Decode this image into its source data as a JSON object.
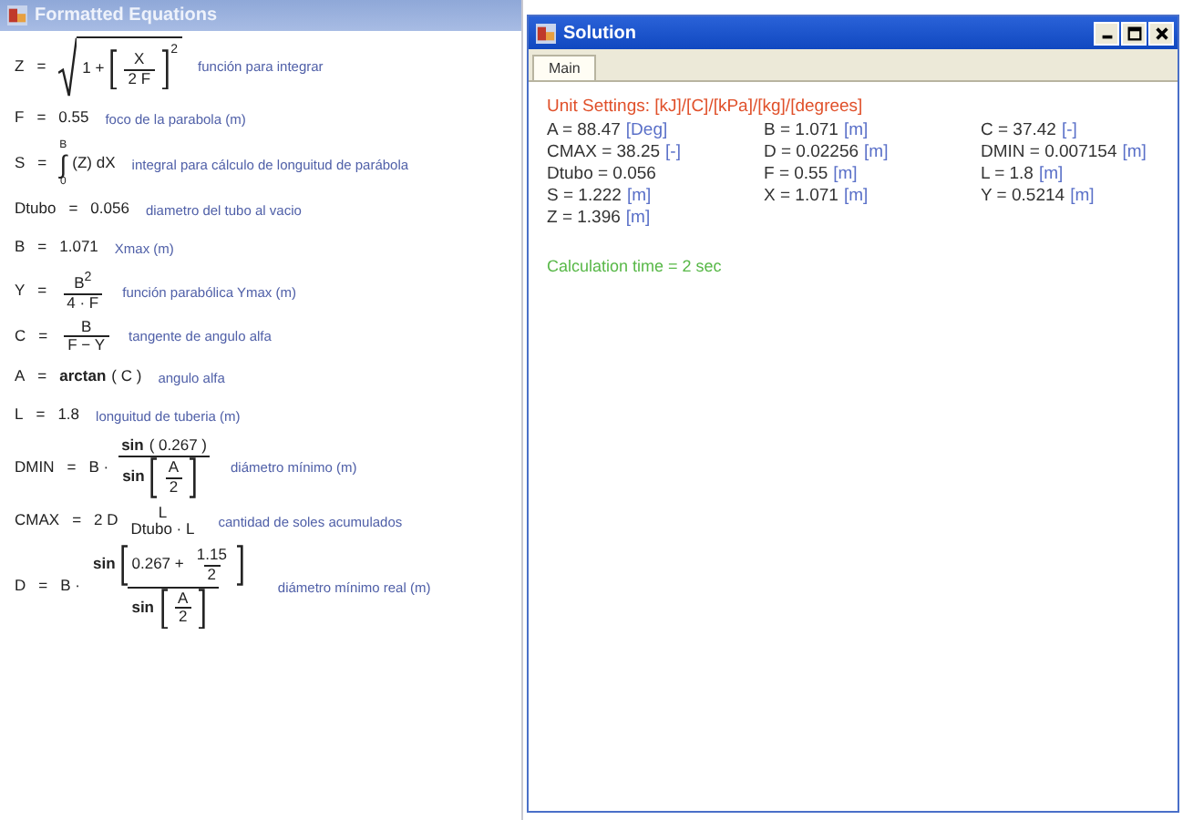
{
  "equations_window": {
    "title": "Formatted Equations"
  },
  "equations": [
    {
      "lhs": "Z",
      "op": "=",
      "expr": [
        {
          "kind": "sqrt",
          "body": [
            {
              "kind": "text",
              "text": "1 +"
            },
            {
              "kind": "brackets",
              "sup": "2",
              "body": [
                {
                  "kind": "frac",
                  "num": [
                    {
                      "kind": "text",
                      "text": "X"
                    }
                  ],
                  "den": [
                    {
                      "kind": "text",
                      "text": "2 F"
                    }
                  ]
                }
              ]
            }
          ]
        }
      ],
      "comment": "función para integrar"
    },
    {
      "lhs": "F",
      "op": "=",
      "expr": [
        {
          "kind": "text",
          "text": "0.55"
        }
      ],
      "comment": "foco de la parabola (m)"
    },
    {
      "lhs": "S",
      "op": "=",
      "expr": [
        {
          "kind": "integral",
          "sign": "∫",
          "upper": "B",
          "lower": "0"
        },
        {
          "kind": "text",
          "text": "(Z)  dX"
        }
      ],
      "comment": "integral para cálculo de longuitud de parábola"
    },
    {
      "lhs": "Dtubo",
      "op": "=",
      "expr": [
        {
          "kind": "text",
          "text": "0.056"
        }
      ],
      "comment": "diametro del tubo al vacio"
    },
    {
      "lhs": "B",
      "op": "=",
      "expr": [
        {
          "kind": "text",
          "text": "1.071"
        }
      ],
      "comment": "Xmax (m)"
    },
    {
      "lhs": "Y",
      "op": "=",
      "expr": [
        {
          "kind": "frac",
          "num": [
            {
              "kind": "text",
              "text": "B$^{2}$"
            }
          ],
          "den": [
            {
              "kind": "text",
              "text": "4 · F"
            }
          ]
        }
      ],
      "comment": "función parabólica Ymax (m)"
    },
    {
      "lhs": "C",
      "op": "=",
      "expr": [
        {
          "kind": "frac",
          "num": [
            {
              "kind": "text",
              "text": "B"
            }
          ],
          "den": [
            {
              "kind": "text",
              "text": "F − Y"
            }
          ]
        }
      ],
      "comment": "tangente de angulo alfa"
    },
    {
      "lhs": "A",
      "op": "=",
      "expr": [
        {
          "kind": "text",
          "text": "arctan",
          "bold": true
        },
        {
          "kind": "text",
          "text": "( C )"
        }
      ],
      "comment": "angulo alfa"
    },
    {
      "lhs": "L",
      "op": "=",
      "expr": [
        {
          "kind": "text",
          "text": "1.8"
        }
      ],
      "comment": "longuitud de tuberia (m)"
    },
    {
      "lhs": "DMIN",
      "op": "=",
      "expr": [
        {
          "kind": "text",
          "text": "B ·"
        },
        {
          "kind": "frac",
          "num": [
            {
              "kind": "text",
              "text": "sin",
              "bold": true
            },
            {
              "kind": "text",
              "text": "( 0.267 )"
            }
          ],
          "den": [
            {
              "kind": "text",
              "text": "sin",
              "bold": true
            },
            {
              "kind": "brackets",
              "body": [
                {
                  "kind": "frac",
                  "num": [
                    {
                      "kind": "text",
                      "text": "A"
                    }
                  ],
                  "den": [
                    {
                      "kind": "text",
                      "text": "2"
                    }
                  ]
                }
              ]
            }
          ]
        }
      ],
      "comment": "diámetro mínimo (m)"
    },
    {
      "lhs": "CMAX",
      "op": "=",
      "expr": [
        {
          "kind": "text",
          "text": "2   D"
        },
        {
          "kind": "frac",
          "plain": true,
          "num": [
            {
              "kind": "text",
              "text": "L"
            }
          ],
          "den": [
            {
              "kind": "text",
              "text": "Dtubo · L"
            }
          ]
        }
      ],
      "comment": "cantidad de soles acumulados"
    },
    {
      "lhs": "D",
      "op": "=",
      "expr": [
        {
          "kind": "text",
          "text": "B ·"
        },
        {
          "kind": "frac",
          "num": [
            {
              "kind": "text",
              "text": "sin",
              "bold": true
            },
            {
              "kind": "brackets",
              "body": [
                {
                  "kind": "text",
                  "text": "0.267 +"
                },
                {
                  "kind": "frac",
                  "num": [
                    {
                      "kind": "text",
                      "text": "1.15"
                    }
                  ],
                  "den": [
                    {
                      "kind": "text",
                      "text": "2"
                    }
                  ]
                }
              ]
            }
          ],
          "den": [
            {
              "kind": "text",
              "text": "sin",
              "bold": true
            },
            {
              "kind": "brackets",
              "body": [
                {
                  "kind": "frac",
                  "num": [
                    {
                      "kind": "text",
                      "text": "A"
                    }
                  ],
                  "den": [
                    {
                      "kind": "text",
                      "text": "2"
                    }
                  ]
                }
              ]
            }
          ]
        }
      ],
      "comment": "diámetro mínimo real (m)"
    }
  ],
  "solution_window": {
    "title": "Solution"
  },
  "tabs": [
    {
      "label": "Main",
      "selected": true
    }
  ],
  "unit_settings": "Unit Settings: [kJ]/[C]/[kPa]/[kg]/[degrees]",
  "results": [
    {
      "value": "A = 88.47",
      "unit": "[Deg]"
    },
    {
      "value": "B = 1.071",
      "unit": "[m]"
    },
    {
      "value": "C = 37.42",
      "unit": "[-]"
    },
    {
      "value": "CMAX = 38.25",
      "unit": "[-]"
    },
    {
      "value": "D = 0.02256",
      "unit": "[m]"
    },
    {
      "value": "DMIN = 0.007154",
      "unit": "[m]"
    },
    {
      "value": "Dtubo = 0.056"
    },
    {
      "value": "F = 0.55",
      "unit": "[m]"
    },
    {
      "value": "L = 1.8",
      "unit": "[m]"
    },
    {
      "value": "S = 1.222",
      "unit": "[m]"
    },
    {
      "value": "X = 1.071",
      "unit": "[m]"
    },
    {
      "value": "Y = 0.5214",
      "unit": "[m]"
    },
    {
      "value": "Z = 1.396",
      "unit": "[m]"
    }
  ],
  "calculation_time": "Calculation time = 2 sec"
}
